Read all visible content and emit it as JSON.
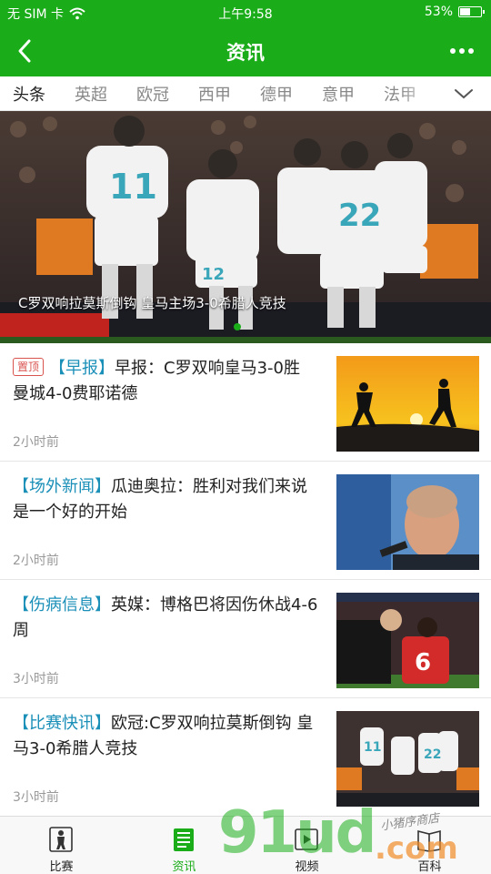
{
  "status_bar": {
    "carrier": "无 SIM 卡",
    "time": "上午9:58",
    "battery_percent": "53%",
    "battery_level": 0.53
  },
  "nav": {
    "title": "资讯"
  },
  "tabs": [
    {
      "label": "头条",
      "active": true
    },
    {
      "label": "英超",
      "active": false
    },
    {
      "label": "欧冠",
      "active": false
    },
    {
      "label": "西甲",
      "active": false
    },
    {
      "label": "德甲",
      "active": false
    },
    {
      "label": "意甲",
      "active": false
    },
    {
      "label": "法甲",
      "active": false
    }
  ],
  "banner": {
    "caption": "C罗双响拉莫斯倒钩 皇马主场3-0希腊人竞技"
  },
  "news": [
    {
      "badge": "置顶",
      "tag": "【早报】",
      "title": "早报：C罗双响皇马3-0胜 曼城4-0费耶诺德",
      "time": "2小时前"
    },
    {
      "badge": "",
      "tag": "【场外新闻】",
      "title": "瓜迪奥拉：胜利对我们来说是一个好的开始",
      "time": "2小时前"
    },
    {
      "badge": "",
      "tag": "【伤病信息】",
      "title": "英媒：博格巴将因伤休战4-6周",
      "time": "3小时前"
    },
    {
      "badge": "",
      "tag": "【比赛快讯】",
      "title": "欧冠:C罗双响拉莫斯倒钩 皇马3-0希腊人竞技",
      "time": "3小时前"
    }
  ],
  "tab_bar": [
    {
      "label": "比赛",
      "icon": "player-icon",
      "active": false
    },
    {
      "label": "资讯",
      "icon": "news-icon",
      "active": true
    },
    {
      "label": "视频",
      "icon": "video-icon",
      "active": false
    },
    {
      "label": "百科",
      "icon": "book-icon",
      "active": false
    }
  ],
  "watermark": {
    "brand": "91ud",
    "domain": ".com",
    "slogan": "小猪序商店"
  },
  "colors": {
    "brand_green": "#1aad19",
    "tag_blue": "#1a8fb8",
    "pin_red": "#d9534f"
  }
}
